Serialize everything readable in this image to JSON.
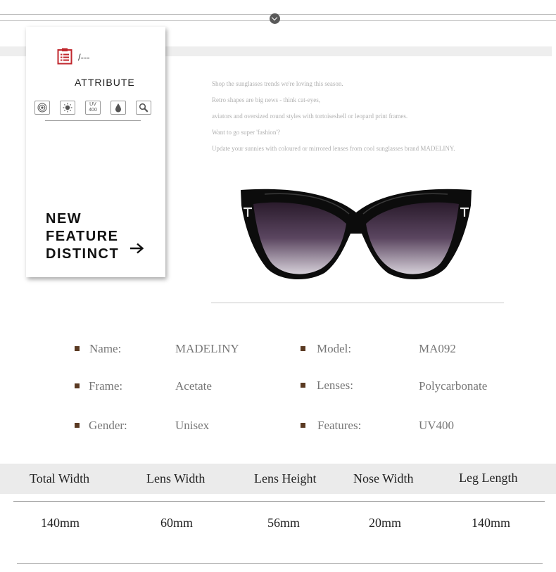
{
  "card": {
    "dash": "/---",
    "title": "ATTRIBUTE",
    "uv_label_top": "UV",
    "uv_label_bottom": "400",
    "feature_line1": "NEW",
    "feature_line2": "FEATURE",
    "feature_line3": "DISTINCT",
    "icons": [
      "target-icon",
      "sun-icon",
      "uv400-icon",
      "water-drop-icon",
      "magnifier-icon"
    ],
    "accent_color": "#c0272d"
  },
  "intro": {
    "lines": [
      "Shop the sunglasses trends we're loving this season.",
      "Retro shapes are big news - think cat-eyes,",
      "aviators and oversized round styles with tortoiseshell or leopard print frames.",
      "Want to go super 'fashion'?",
      "Update your sunnies with coloured or mirrored lenses from cool sunglasses brand MADELINY."
    ]
  },
  "specs": {
    "name_label": "Name:",
    "name_value": "MADELINY",
    "model_label": "Model:",
    "model_value": "MA092",
    "frame_label": "Frame:",
    "frame_value": "Acetate",
    "lenses_label": "Lenses:",
    "lenses_value": "Polycarbonate",
    "gender_label": "Gender:",
    "gender_value": "Unisex",
    "features_label": "Features:",
    "features_value": "UV400"
  },
  "sizes": {
    "headers": [
      "Total Width",
      "Lens Width",
      "Lens Height",
      "Nose Width",
      "Leg Length"
    ],
    "values": [
      "140mm",
      "60mm",
      "56mm",
      "20mm",
      "140mm"
    ]
  }
}
